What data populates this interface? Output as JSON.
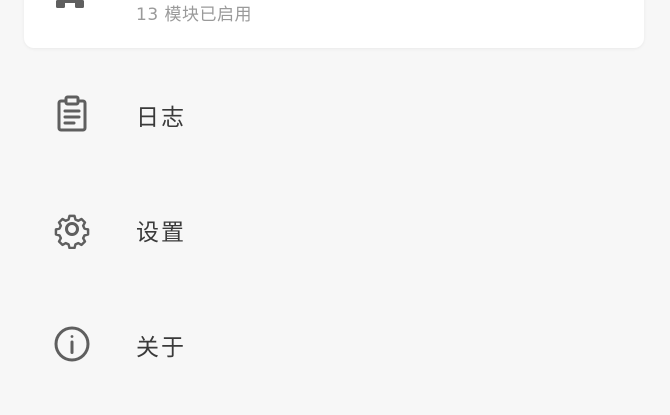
{
  "modules_card": {
    "icon": "extension-icon",
    "subtitle": "13 模块已启用"
  },
  "menu": [
    {
      "label": "日志",
      "icon": "clipboard-text-icon"
    },
    {
      "label": "设置",
      "icon": "gear-icon"
    },
    {
      "label": "关于",
      "icon": "info-circle-icon"
    }
  ],
  "colors": {
    "background": "#f7f7f7",
    "card": "#ffffff",
    "icon": "#5f5f5f",
    "label": "#3a3a3a",
    "subtitle": "#9a9a9a"
  }
}
